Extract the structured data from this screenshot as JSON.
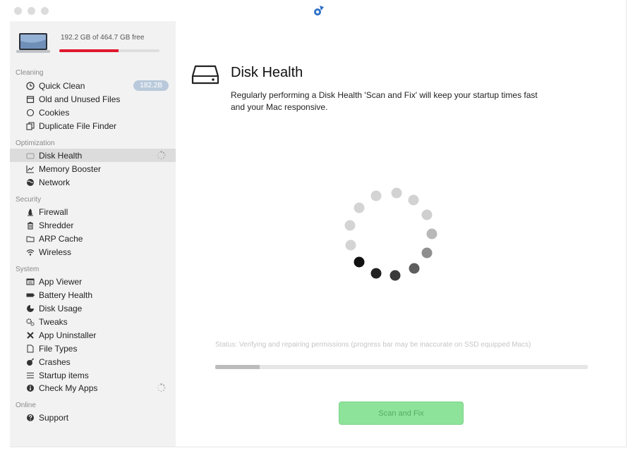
{
  "window": {
    "traffic_lights": [
      "close",
      "minimize",
      "zoom"
    ],
    "app_logo_icon": "app-logo-icon"
  },
  "sidebar": {
    "disk": {
      "free_text": "192.2 GB of 464.7 GB free",
      "used_fraction": 0.59,
      "bar_color": "#e0182d"
    },
    "sections": [
      {
        "title": "Cleaning",
        "items": [
          {
            "label": "Quick Clean",
            "icon": "clock-icon",
            "badge": "182.2B"
          },
          {
            "label": "Old and Unused Files",
            "icon": "calendar-icon"
          },
          {
            "label": "Cookies",
            "icon": "circle-icon"
          },
          {
            "label": "Duplicate File Finder",
            "icon": "duplicate-icon"
          }
        ]
      },
      {
        "title": "Optimization",
        "items": [
          {
            "label": "Disk Health",
            "icon": "disk-icon",
            "selected": true,
            "spinner": true
          },
          {
            "label": "Memory Booster",
            "icon": "chart-icon"
          },
          {
            "label": "Network",
            "icon": "globe-icon"
          }
        ]
      },
      {
        "title": "Security",
        "items": [
          {
            "label": "Firewall",
            "icon": "flame-icon"
          },
          {
            "label": "Shredder",
            "icon": "trash-icon"
          },
          {
            "label": "ARP Cache",
            "icon": "folder-icon"
          },
          {
            "label": "Wireless",
            "icon": "wifi-icon"
          }
        ]
      },
      {
        "title": "System",
        "items": [
          {
            "label": "App Viewer",
            "icon": "window-icon"
          },
          {
            "label": "Battery Health",
            "icon": "battery-icon"
          },
          {
            "label": "Disk Usage",
            "icon": "pie-icon"
          },
          {
            "label": "Tweaks",
            "icon": "gears-icon"
          },
          {
            "label": "App Uninstaller",
            "icon": "x-icon"
          },
          {
            "label": "File Types",
            "icon": "file-icon"
          },
          {
            "label": "Crashes",
            "icon": "bomb-icon"
          },
          {
            "label": "Startup items",
            "icon": "list-icon"
          },
          {
            "label": "Check My Apps",
            "icon": "info-icon",
            "spinner": true
          }
        ]
      },
      {
        "title": "Online",
        "items": [
          {
            "label": "Support",
            "icon": "question-icon"
          }
        ]
      }
    ]
  },
  "main": {
    "title": "Disk Health",
    "description": "Regularly performing a Disk Health 'Scan and Fix' will keep your startup times fast and your Mac responsive.",
    "status": "Status: Verifying and repairing permissions (progress bar may be inaccurate on SSD equipped Macs)",
    "progress_fraction": 0.12,
    "scan_button_label": "Scan and Fix",
    "accent_green": "#8ee39a"
  }
}
